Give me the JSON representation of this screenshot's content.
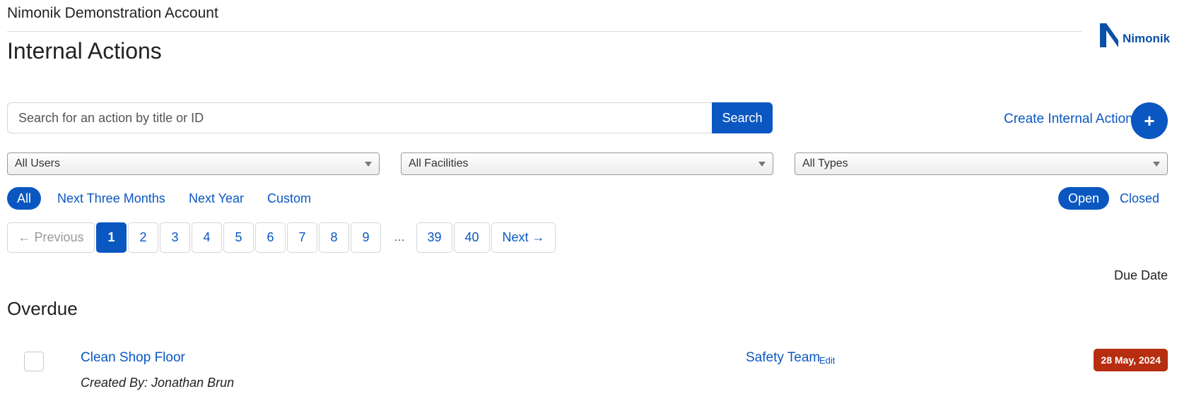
{
  "header": {
    "account_name": "Nimonik Demonstration Account",
    "page_title": "Internal Actions",
    "logo_text": "Nimonik"
  },
  "search": {
    "placeholder": "Search for an action by title or ID",
    "button_label": "Search"
  },
  "create": {
    "label": "Create Internal Action",
    "button_symbol": "+"
  },
  "filters": {
    "users": "All Users",
    "facilities": "All Facilities",
    "types": "All Types"
  },
  "time_filters": [
    {
      "label": "All",
      "active": true
    },
    {
      "label": "Next Three Months",
      "active": false
    },
    {
      "label": "Next Year",
      "active": false
    },
    {
      "label": "Custom",
      "active": false
    }
  ],
  "status_filters": [
    {
      "label": "Open",
      "active": true
    },
    {
      "label": "Closed",
      "active": false
    }
  ],
  "pagination": {
    "previous": "← Previous",
    "next": "Next →",
    "pages": [
      "1",
      "2",
      "3",
      "4",
      "5",
      "6",
      "7",
      "8",
      "9"
    ],
    "ellipsis": "…",
    "last_pages": [
      "39",
      "40"
    ],
    "current": "1"
  },
  "list": {
    "sort_label": "Due Date",
    "section_title": "Overdue",
    "items": [
      {
        "title": "Clean Shop Floor",
        "created_by": "Created By: Jonathan Brun",
        "team": "Safety Team",
        "edit_label": "Edit",
        "due_date": "28 May, 2024"
      }
    ]
  },
  "colors": {
    "primary": "#0a57c2",
    "overdue": "#b72d10"
  }
}
